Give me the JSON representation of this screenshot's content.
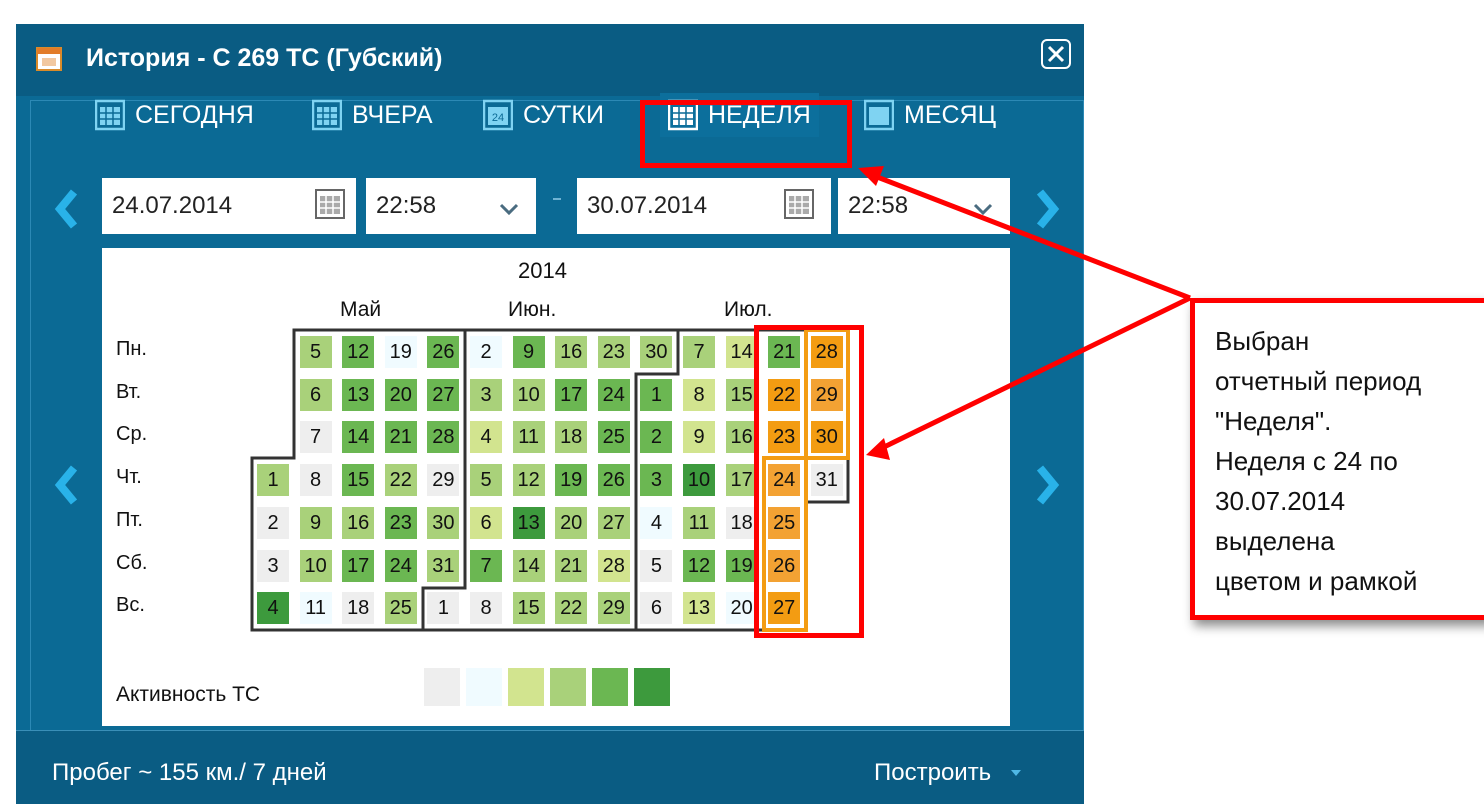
{
  "window": {
    "title": "История - С 269 ТС (Губский)"
  },
  "periods": [
    {
      "label": "СЕГОДНЯ"
    },
    {
      "label": "ВЧЕРА"
    },
    {
      "label": "СУТКИ",
      "icon_text": "24"
    },
    {
      "label": "НЕДЕЛЯ",
      "selected": true
    },
    {
      "label": "МЕСЯЦ"
    }
  ],
  "range": {
    "from_date": "24.07.2014",
    "from_time": "22:58",
    "to_date": "30.07.2014",
    "to_time": "22:58"
  },
  "calendar": {
    "year": "2014",
    "months": [
      "Май",
      "Июн.",
      "Июл."
    ],
    "weekdays": [
      "Пн.",
      "Вт.",
      "Ср.",
      "Чт.",
      "Пт.",
      "Сб.",
      "Вс."
    ],
    "days": [
      [
        "",
        "5",
        "12",
        "19",
        "26",
        "2",
        "9",
        "16",
        "23",
        "30",
        "7",
        "14",
        "21",
        "28"
      ],
      [
        "",
        "6",
        "13",
        "20",
        "27",
        "3",
        "10",
        "17",
        "24",
        "1",
        "8",
        "15",
        "22",
        "29"
      ],
      [
        "",
        "7",
        "14",
        "21",
        "28",
        "4",
        "11",
        "18",
        "25",
        "2",
        "9",
        "16",
        "23",
        "30"
      ],
      [
        "1",
        "8",
        "15",
        "22",
        "29",
        "5",
        "12",
        "19",
        "26",
        "3",
        "10",
        "17",
        "24",
        "31"
      ],
      [
        "2",
        "9",
        "16",
        "23",
        "30",
        "6",
        "13",
        "20",
        "27",
        "4",
        "11",
        "18",
        "25",
        ""
      ],
      [
        "3",
        "10",
        "17",
        "24",
        "31",
        "7",
        "14",
        "21",
        "28",
        "5",
        "12",
        "19",
        "26",
        ""
      ],
      [
        "4",
        "11",
        "18",
        "25",
        "1",
        "8",
        "15",
        "22",
        "29",
        "6",
        "13",
        "20",
        "27",
        ""
      ]
    ],
    "levels": [
      [
        -1,
        3,
        4,
        1,
        4,
        1,
        4,
        3,
        3,
        3,
        3,
        2,
        4,
        6
      ],
      [
        -1,
        3,
        4,
        4,
        4,
        3,
        3,
        4,
        4,
        4,
        2,
        3,
        6,
        7
      ],
      [
        -1,
        0,
        4,
        4,
        4,
        2,
        3,
        3,
        4,
        4,
        2,
        3,
        6,
        6
      ],
      [
        3,
        0,
        4,
        3,
        0,
        3,
        3,
        4,
        4,
        4,
        5,
        3,
        7,
        0
      ],
      [
        0,
        3,
        3,
        4,
        3,
        2,
        5,
        3,
        3,
        1,
        3,
        0,
        7,
        -1
      ],
      [
        0,
        3,
        4,
        4,
        3,
        4,
        3,
        3,
        2,
        0,
        4,
        4,
        7,
        -1
      ],
      [
        5,
        1,
        0,
        3,
        0,
        0,
        3,
        3,
        3,
        0,
        2,
        1,
        6,
        -1
      ]
    ],
    "legend_label": "Активность ТС",
    "activity_colors": [
      "#eeeeee",
      "#f0fbff",
      "#d2e48f",
      "#a9d17a",
      "#6bb752",
      "#3d9a3d",
      "#f39c12",
      "#f3a233"
    ]
  },
  "footer": {
    "mileage": "Пробег ~ 155 км./ 7 дней",
    "build_label": "Построить"
  },
  "callout": {
    "lines": [
      "Выбран",
      "отчетный период",
      "\"Неделя\".",
      "Неделя с 24 по",
      "30.07.2014",
      "выделена",
      "цветом и рамкой"
    ]
  },
  "colors": {
    "window_bg": "#0b6a95",
    "titlebar_bg": "#0a5c83",
    "annotation_red": "#ff0000",
    "selected_week": "#f39c12"
  }
}
